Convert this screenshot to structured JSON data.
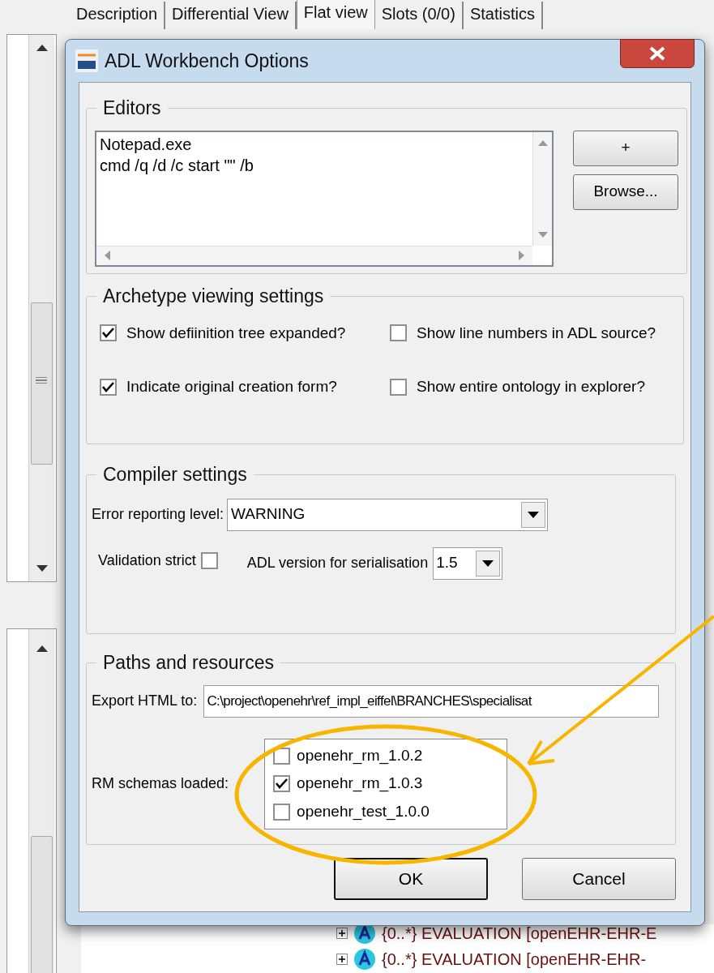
{
  "background": {
    "tabs": [
      {
        "label": "Description",
        "selected": false
      },
      {
        "label": "Differential View",
        "selected": false
      },
      {
        "label": "Flat view",
        "selected": true
      },
      {
        "label": "Slots (0/0)",
        "selected": false
      },
      {
        "label": "Statistics",
        "selected": false
      }
    ],
    "tree_rows": [
      {
        "text": "{0..*} EVALUATION [openEHR-EHR-E"
      },
      {
        "text": "{0..*} EVALUATION [openEHR-EHR-"
      }
    ]
  },
  "dialog": {
    "title": "ADL Workbench Options",
    "editors": {
      "legend": "Editors",
      "lines": [
        "Notepad.exe",
        "cmd /q /d /c start \"\" /b"
      ],
      "buttons": [
        "+",
        "Browse..."
      ]
    },
    "archetype_viewing": {
      "legend": "Archetype viewing settings",
      "options": [
        {
          "label": "Show defiinition tree expanded?",
          "checked": true
        },
        {
          "label": "Show line numbers in ADL source?",
          "checked": false
        },
        {
          "label": "Indicate original creation form?",
          "checked": true
        },
        {
          "label": "Show entire ontology in explorer?",
          "checked": false
        }
      ]
    },
    "compiler": {
      "legend": "Compiler settings",
      "error_level": {
        "label": "Error reporting level:",
        "value": "WARNING"
      },
      "validation_strict": {
        "label": "Validation strict",
        "checked": false
      },
      "adl_version": {
        "label": "ADL version for serialisation",
        "value": "1.5"
      }
    },
    "paths": {
      "legend": "Paths and resources",
      "export_html": {
        "label": "Export HTML to:",
        "value": "C:\\project\\openehr\\ref_impl_eiffel\\BRANCHES\\specialisat"
      },
      "rm_schemas": {
        "label": "RM schemas loaded:",
        "items": [
          {
            "label": "openehr_rm_1.0.2",
            "checked": false
          },
          {
            "label": "openehr_rm_1.0.3",
            "checked": true
          },
          {
            "label": "openehr_test_1.0.0",
            "checked": false
          }
        ]
      }
    },
    "buttons": [
      {
        "label": "OK",
        "default": true
      },
      {
        "label": "Cancel",
        "default": false
      }
    ]
  }
}
